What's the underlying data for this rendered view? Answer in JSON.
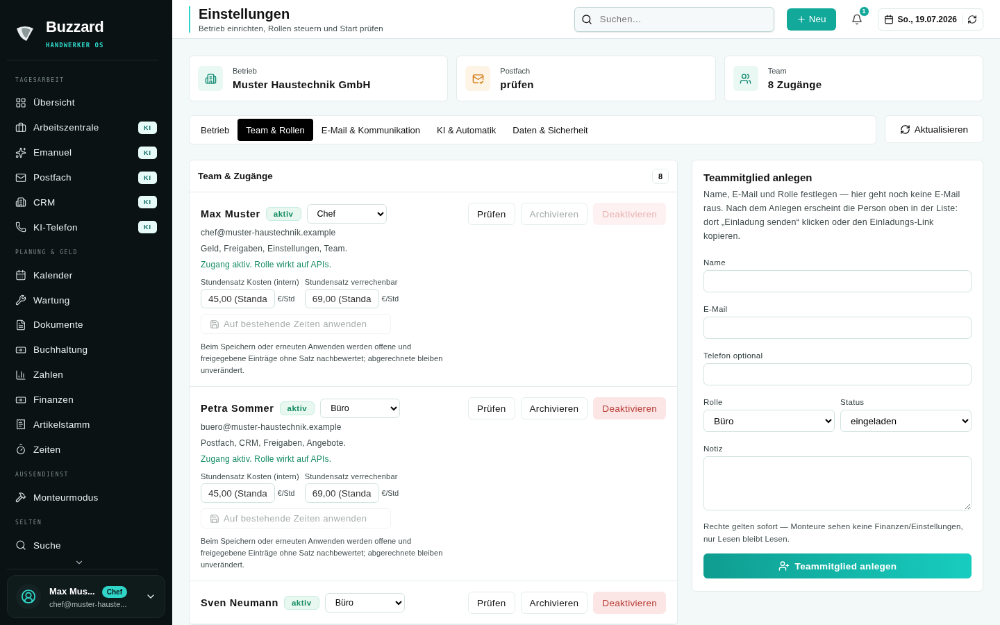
{
  "brand": {
    "name": "Buzzard",
    "tagline": "HANDWERKER OS"
  },
  "sidebar": {
    "sections": [
      {
        "title": "TAGESARBEIT",
        "items": [
          {
            "label": "Übersicht"
          },
          {
            "label": "Arbeitszentrale",
            "badge": "KI"
          },
          {
            "label": "Emanuel",
            "badge": "KI"
          },
          {
            "label": "Postfach",
            "badge": "KI"
          },
          {
            "label": "CRM",
            "badge": "KI"
          },
          {
            "label": "KI-Telefon",
            "badge": "KI"
          }
        ]
      },
      {
        "title": "PLANUNG & GELD",
        "items": [
          {
            "label": "Kalender"
          },
          {
            "label": "Wartung"
          },
          {
            "label": "Dokumente"
          },
          {
            "label": "Buchhaltung"
          },
          {
            "label": "Zahlen"
          },
          {
            "label": "Finanzen"
          },
          {
            "label": "Artikelstamm"
          },
          {
            "label": "Zeiten"
          }
        ]
      },
      {
        "title": "AUSSENDIENST",
        "items": [
          {
            "label": "Monteurmodus"
          }
        ]
      },
      {
        "title": "SELTEN",
        "items": [
          {
            "label": "Suche"
          }
        ]
      }
    ],
    "user": {
      "name": "Max Mus...",
      "email": "chef@muster-hauste...",
      "role": "Chef"
    }
  },
  "header": {
    "title": "Einstellungen",
    "subtitle": "Betrieb einrichten, Rollen steuern und Start prüfen",
    "search_placeholder": "Suchen...",
    "new_button": "Neu",
    "notifications": "1",
    "date": "So., 19.07.2026"
  },
  "stats": [
    {
      "label": "Betrieb",
      "value": "Muster Haustechnik GmbH"
    },
    {
      "label": "Postfach",
      "value": "prüfen"
    },
    {
      "label": "Team",
      "value": "8 Zugänge"
    }
  ],
  "tabs": [
    {
      "label": "Betrieb",
      "selected": false
    },
    {
      "label": "Team & Rollen",
      "selected": true
    },
    {
      "label": "E-Mail & Kommunikation",
      "selected": false
    },
    {
      "label": "KI & Automatik",
      "selected": false
    },
    {
      "label": "Daten & Sicherheit",
      "selected": false
    }
  ],
  "refresh_button": "Aktualisieren",
  "team": {
    "title": "Team & Zugänge",
    "count": "8",
    "members": [
      {
        "name": "Max Muster",
        "status": "aktiv",
        "role": "Chef",
        "email": "chef@muster-haustechnik.example",
        "rights": "Geld, Freigaben, Einstellungen, Team.",
        "access": "Zugang aktiv. Rolle wirkt auf APIs.",
        "cost_label": "Stundensatz Kosten (intern)",
        "cost_value": "45,00 (Standa",
        "cost_unit": "€/Std",
        "bill_label": "Stundensatz verrechenbar",
        "bill_value": "69,00 (Standa",
        "bill_unit": "€/Std",
        "apply_button": {
          "label": "Auf bestehende Zeiten anwenden",
          "disabled": true
        },
        "note": "Beim Speichern oder erneuten Anwenden werden offene und freigegebene Einträge ohne Satz nachbewertet; abgerechnete bleiben unverändert.",
        "buttons": [
          {
            "label": "Prüfen",
            "kind": "plain",
            "disabled": false
          },
          {
            "label": "Archivieren",
            "kind": "plain",
            "disabled": true
          },
          {
            "label": "Deaktivieren",
            "kind": "danger",
            "disabled": true
          }
        ]
      },
      {
        "name": "Petra Sommer",
        "status": "aktiv",
        "role": "Büro",
        "email": "buero@muster-haustechnik.example",
        "rights": "Postfach, CRM, Freigaben, Angebote.",
        "access": "Zugang aktiv. Rolle wirkt auf APIs.",
        "cost_label": "Stundensatz Kosten (intern)",
        "cost_value": "45,00 (Standa",
        "cost_unit": "€/Std",
        "bill_label": "Stundensatz verrechenbar",
        "bill_value": "69,00 (Standa",
        "bill_unit": "€/Std",
        "apply_button": {
          "label": "Auf bestehende Zeiten anwenden",
          "disabled": true
        },
        "note": "Beim Speichern oder erneuten Anwenden werden offene und freigegebene Einträge ohne Satz nachbewertet; abgerechnete bleiben unverändert.",
        "buttons": [
          {
            "label": "Prüfen",
            "kind": "plain",
            "disabled": false
          },
          {
            "label": "Archivieren",
            "kind": "plain",
            "disabled": false
          },
          {
            "label": "Deaktivieren",
            "kind": "danger",
            "disabled": false
          }
        ]
      },
      {
        "name": "Sven Neumann",
        "status": "aktiv",
        "role": "Büro",
        "buttons": [
          {
            "label": "Prüfen",
            "kind": "plain",
            "disabled": false
          },
          {
            "label": "Archivieren",
            "kind": "plain",
            "disabled": false
          },
          {
            "label": "Deaktivieren",
            "kind": "danger",
            "disabled": false
          }
        ]
      }
    ]
  },
  "form": {
    "title": "Teammitglied anlegen",
    "description": "Name, E-Mail und Rolle festlegen — hier geht noch keine E-Mail raus. Nach dem Anlegen erscheint die Person oben in der Liste: dort „Einladung senden“ klicken oder den Einladungs-Link kopieren.",
    "name_label": "Name",
    "email_label": "E-Mail",
    "phone_label": "Telefon optional",
    "role_label": "Rolle",
    "role_value": "Büro",
    "status_label": "Status",
    "status_value": "eingeladen",
    "note_label": "Notiz",
    "hint": "Rechte gelten sofort — Monteure sehen keine Finanzen/Einstellungen, nur Lesen bleibt Lesen.",
    "submit": "Teammitglied anlegen"
  }
}
